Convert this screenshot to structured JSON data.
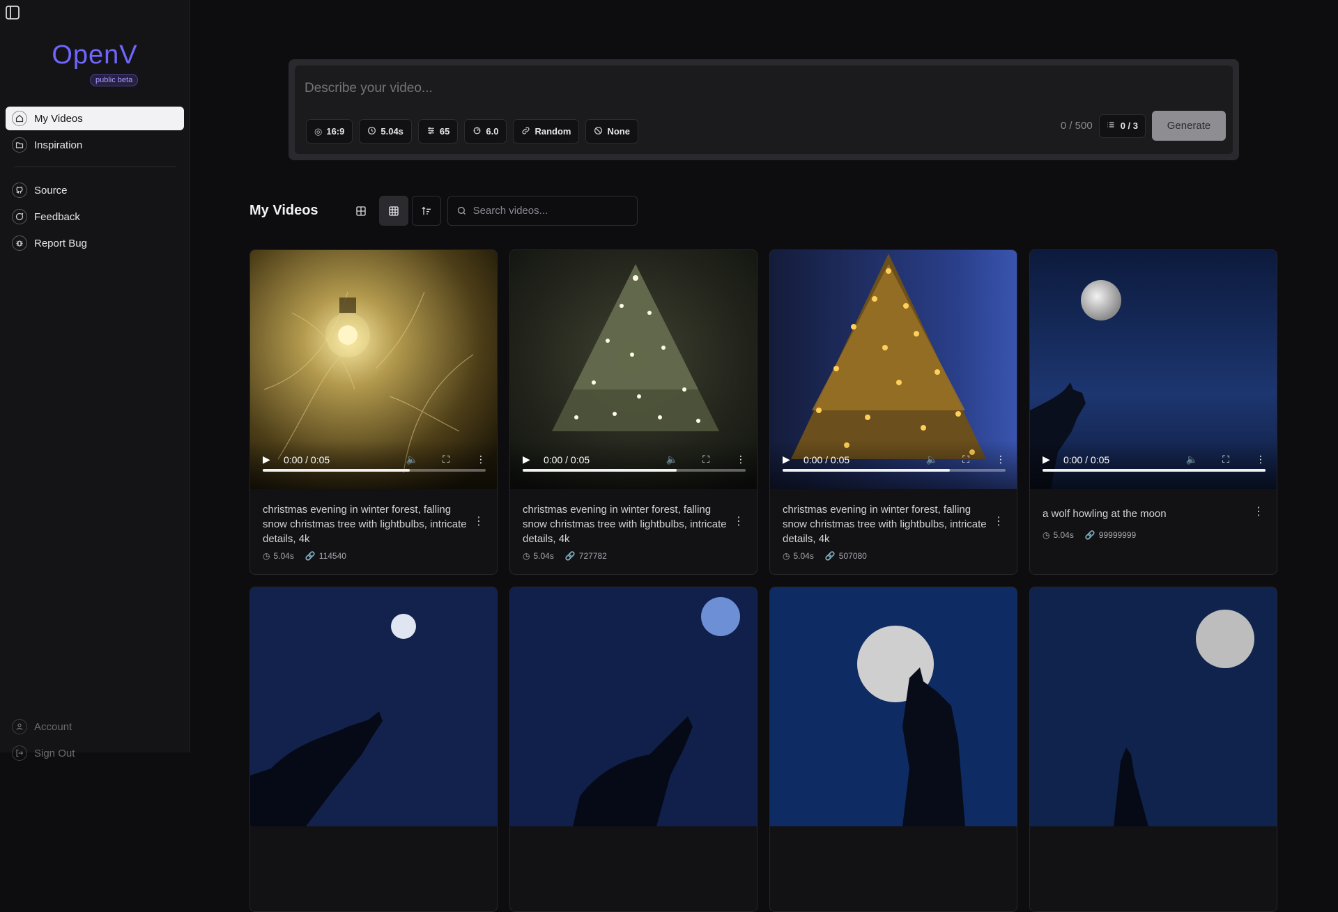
{
  "app": {
    "logo": "OpenV",
    "badge": "public beta"
  },
  "sidebar": {
    "items": [
      {
        "label": "My Videos",
        "icon": "home-icon",
        "active": true
      },
      {
        "label": "Inspiration",
        "icon": "folder-icon",
        "active": false
      }
    ],
    "links": [
      {
        "label": "Source",
        "icon": "github-icon"
      },
      {
        "label": "Feedback",
        "icon": "chat-icon"
      },
      {
        "label": "Report Bug",
        "icon": "bug-icon"
      }
    ],
    "bottom": [
      {
        "label": "Account",
        "icon": "user-icon"
      },
      {
        "label": "Sign Out",
        "icon": "logout-icon"
      }
    ]
  },
  "prompt": {
    "placeholder": "Describe your video...",
    "chips": {
      "aspect": "16:9",
      "duration": "5.04s",
      "steps": "65",
      "guidance": "6.0",
      "seed": "Random",
      "negative": "None"
    },
    "char_count": "0 / 500",
    "queue": "0 / 3",
    "generate_label": "Generate"
  },
  "section": {
    "title": "My Videos",
    "search_placeholder": "Search videos..."
  },
  "player": {
    "time": "0:00 / 0:05"
  },
  "videos": [
    {
      "caption": "christmas evening in winter forest, falling snow christmas tree with lightbulbs, intricate details, 4k",
      "duration": "5.04s",
      "seed": "114540",
      "progress": 0.66
    },
    {
      "caption": "christmas evening in winter forest, falling snow christmas tree with lightbulbs, intricate details, 4k",
      "duration": "5.04s",
      "seed": "727782",
      "progress": 0.69
    },
    {
      "caption": "christmas evening in winter forest, falling snow christmas tree with lightbulbs, intricate details, 4k",
      "duration": "5.04s",
      "seed": "507080",
      "progress": 0.75
    },
    {
      "caption": "a wolf howling at the moon",
      "duration": "5.04s",
      "seed": "99999999",
      "progress": 1.0
    }
  ],
  "colors": {
    "accent": "#6f65ff",
    "background": "#0d0d10",
    "sidebar": "#141417"
  }
}
